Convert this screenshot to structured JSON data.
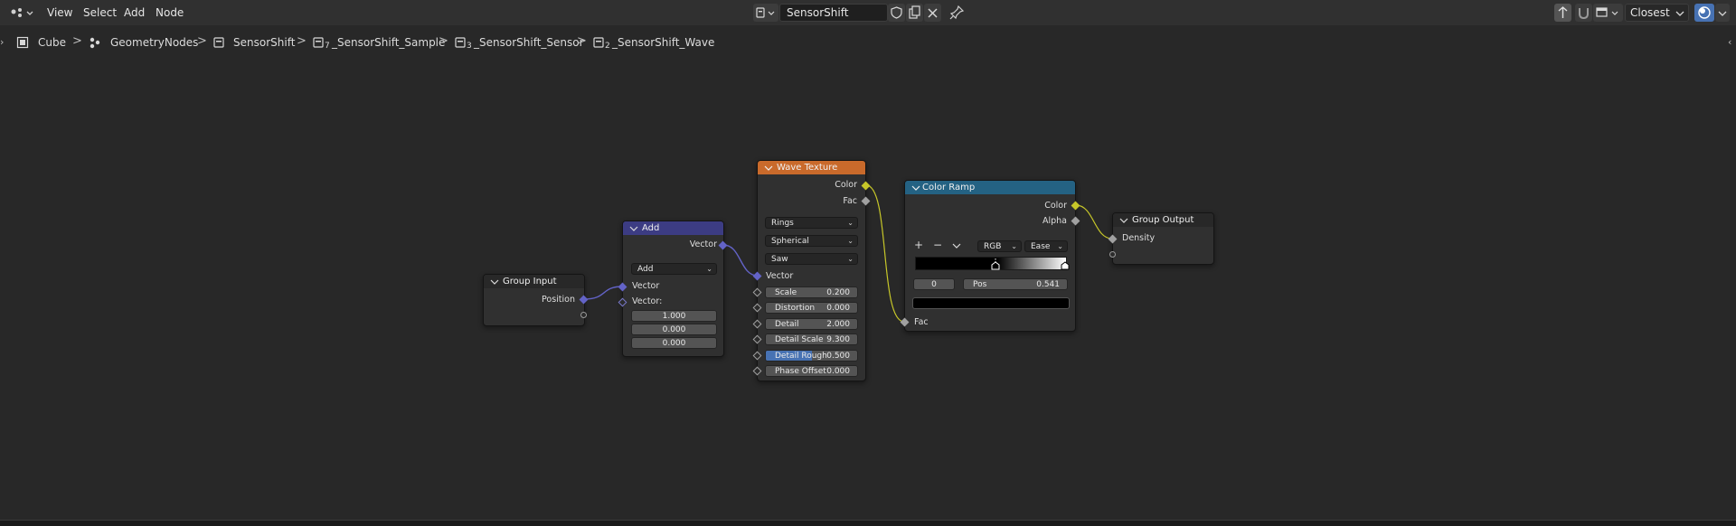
{
  "menu": {
    "view": "View",
    "select": "Select",
    "add": "Add",
    "node": "Node"
  },
  "node_tree": {
    "name": "SensorShift"
  },
  "header_right": {
    "interpolation": "Closest"
  },
  "breadcrumbs": [
    {
      "label": "Cube"
    },
    {
      "label": "GeometryNodes"
    },
    {
      "label": "SensorShift"
    },
    {
      "label": "_SensorShift_Sample",
      "sub": "7"
    },
    {
      "label": "_SensorShift_Sensor",
      "sub": "3"
    },
    {
      "label": "_SensorShift_Wave",
      "sub": "2"
    }
  ],
  "colors": {
    "editor_bg": "#282828",
    "header_bg": "#303030",
    "vector_socket": "#6363c7",
    "color_socket": "#c7c729",
    "float_socket": "#a1a1a1",
    "input_header": "#282828",
    "vector_header": "#3c3c83",
    "texture_header": "#e66f2e",
    "converter_header": "#246283",
    "selected_field": "#4772b3"
  },
  "nodes": {
    "group_input": {
      "title": "Group Input",
      "outputs": [
        "Position"
      ]
    },
    "add": {
      "title": "Add",
      "output": "Vector",
      "operation": "Add",
      "input1": "Vector",
      "input2": "Vector:",
      "values": [
        "1.000",
        "0.000",
        "0.000"
      ]
    },
    "wave": {
      "title": "Wave Texture",
      "outputs": [
        "Color",
        "Fac"
      ],
      "wave_type": "Rings",
      "direction": "Spherical",
      "profile": "Saw",
      "vector_input": "Vector",
      "fields": [
        {
          "label": "Scale",
          "value": "0.200"
        },
        {
          "label": "Distortion",
          "value": "0.000"
        },
        {
          "label": "Detail",
          "value": "2.000"
        },
        {
          "label": "Detail Scale",
          "value": "9.300"
        },
        {
          "label": "Detail Rough",
          "value": "0.500",
          "fill": 0.5
        },
        {
          "label": "Phase Offset",
          "value": "0.000"
        }
      ]
    },
    "color_ramp": {
      "title": "Color Ramp",
      "outputs": [
        "Color",
        "Alpha"
      ],
      "add": "+",
      "remove": "−",
      "color_mode": "RGB",
      "interpolation": "Ease",
      "index": "0",
      "pos_label": "Pos",
      "pos_value": "0.541",
      "input": "Fac"
    },
    "group_output": {
      "title": "Group Output",
      "inputs": [
        "Density"
      ]
    }
  }
}
